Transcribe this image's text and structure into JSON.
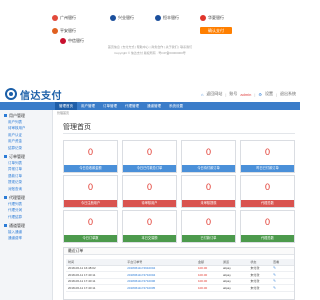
{
  "top_strip": {
    "banks": [
      {
        "name": "广州银行",
        "color": "#e24a3b"
      },
      {
        "name": "兴业银行",
        "color": "#1b4f9c"
      },
      {
        "name": "恒丰银行",
        "color": "#1b4f9c"
      },
      {
        "name": "华夏银行",
        "color": "#e0352b"
      },
      {
        "name": "平安银行",
        "color": "#e06020"
      },
      {
        "name": "中信银行",
        "color": "#c8102e"
      }
    ],
    "pay_button": "确认支付",
    "footer_links": "首页信息 | 支付方式 | 帮助中心 | 商务合作 | 关于我们 | 联系我们",
    "footer_copy": "Copyright © 信达支付 版权所有 · 粤ICP备00000000号"
  },
  "header": {
    "logo_text": "信达支付",
    "back_link": "返回网站",
    "user_prefix": "账号",
    "user": "admin",
    "settings": "设置",
    "logout": "退出系统"
  },
  "nav": {
    "items": [
      "管理首页",
      "用户管理",
      "订单管理",
      "代理管理",
      "通道管理",
      "系统设置"
    ],
    "active_index": 0
  },
  "sidebar": {
    "sections": [
      {
        "title": "用户管理",
        "items": [
          "用户列表",
          "待审核用户",
          "用户认证",
          "用户资金",
          "结算记录"
        ]
      },
      {
        "title": "订单管理",
        "items": [
          "订单列表",
          "异常订单",
          "退款订单",
          "提现记录",
          "对账查询"
        ]
      },
      {
        "title": "代理管理",
        "items": [
          "代理列表",
          "代理分润",
          "代理结算"
        ]
      },
      {
        "title": "通道管理",
        "items": [
          "接入通道",
          "通道费率"
        ]
      }
    ]
  },
  "main": {
    "breadcrumb": "管理首页",
    "page_title": "管理首页",
    "cards": [
      {
        "value": "0",
        "label": "今日总收款金额",
        "style": "blue"
      },
      {
        "value": "0",
        "label": "今日已付款总订单",
        "style": "blue"
      },
      {
        "value": "0",
        "label": "今日待付款订单",
        "style": "blue"
      },
      {
        "value": "0",
        "label": "昨日已付款订单",
        "style": "blue"
      },
      {
        "value": "0",
        "label": "今日注册用户",
        "style": "red"
      },
      {
        "value": "0",
        "label": "待审核用户",
        "style": "red"
      },
      {
        "value": "0",
        "label": "未审核提现",
        "style": "red"
      },
      {
        "value": "0",
        "label": "代理总数",
        "style": "red"
      },
      {
        "value": "0",
        "label": "今日订单数",
        "style": "green"
      },
      {
        "value": "0",
        "label": "本日交易额",
        "style": "green"
      },
      {
        "value": "0",
        "label": "已付款订单",
        "style": "green"
      },
      {
        "value": "0",
        "label": "代理总数",
        "style": "green"
      }
    ],
    "orders": {
      "title": "最近订单",
      "columns": [
        "时间",
        "平台订单号",
        "金额",
        "通道",
        "状态",
        "查看"
      ],
      "rows": [
        {
          "time": "2018-06-11 16:48:02",
          "order_no": "20180611174910004",
          "amount": "100.00",
          "channel": "alipay",
          "status": "未付款"
        },
        {
          "time": "2018-06-11 17:40:11",
          "order_no": "20180611174710004",
          "amount": "100.00",
          "channel": "alipay",
          "status": "未付款"
        },
        {
          "time": "2018-06-11 17:40:11",
          "order_no": "20180611174710006",
          "amount": "100.00",
          "channel": "alipay",
          "status": "未付款"
        },
        {
          "time": "2018-06-11 17:40:11",
          "order_no": "20180611174710005",
          "amount": "100.00",
          "channel": "alipay",
          "status": "未付款"
        }
      ]
    }
  }
}
